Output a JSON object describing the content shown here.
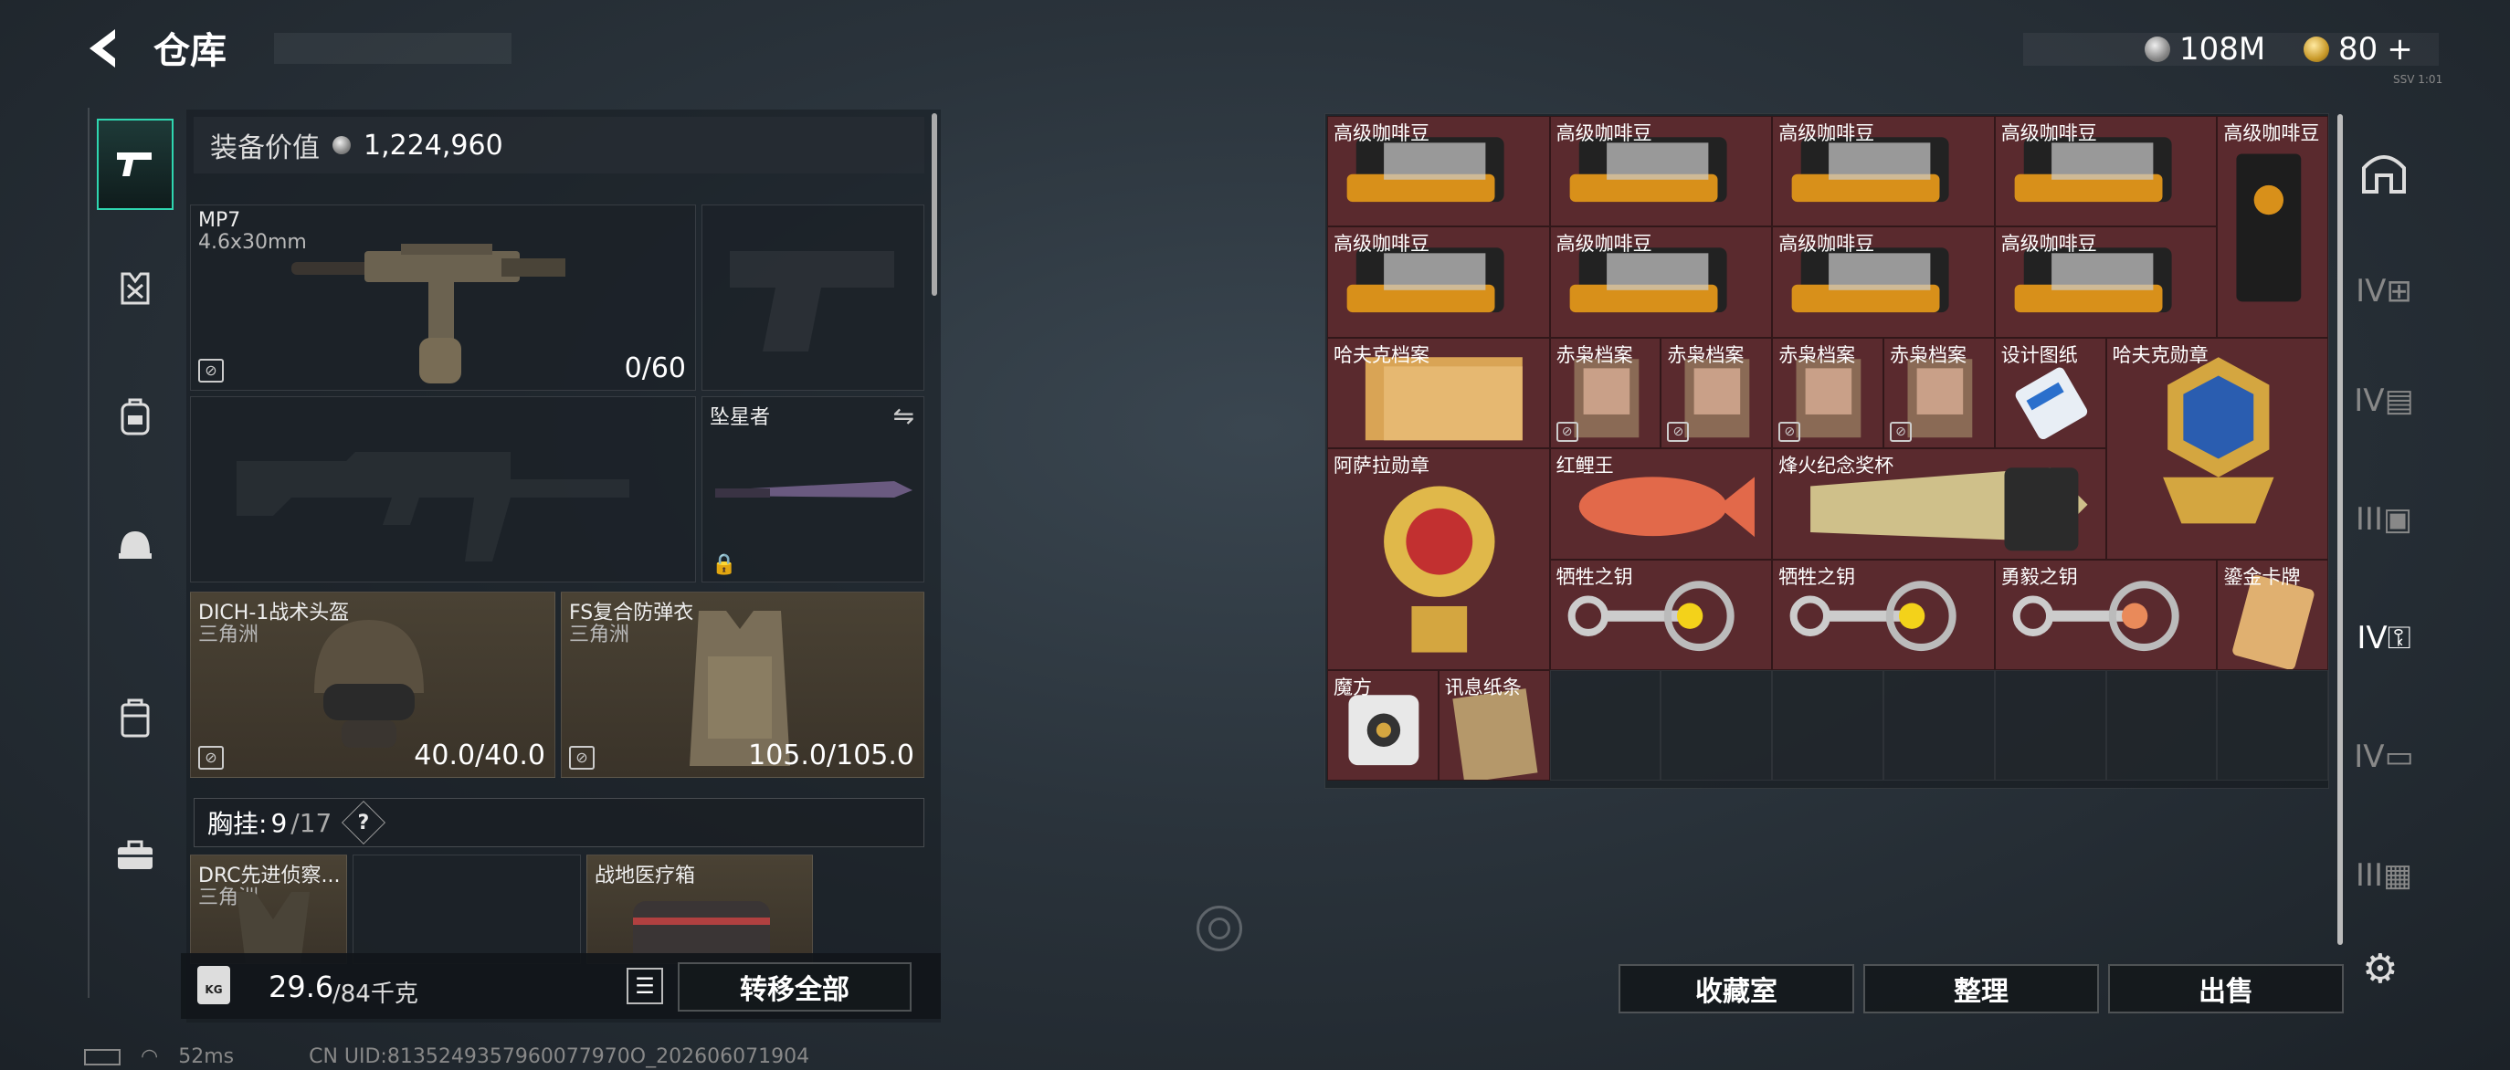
{
  "header": {
    "back_icon": "back-arrow-icon",
    "title": "仓库"
  },
  "currency": {
    "silver": "108M",
    "gold": "80",
    "gold_add": "+",
    "tag": "SSV 1:01"
  },
  "nav": {
    "items": [
      "pistol-icon",
      "vest-icon",
      "backpack-icon",
      "helmet-icon",
      "case-icon",
      "toolbox-icon"
    ],
    "active": 0
  },
  "loadout": {
    "value_label": "装备价值",
    "value": "1,224,960",
    "primary": {
      "name": "MP7",
      "caliber": "4.6x30mm",
      "ammo": "0/60"
    },
    "melee": {
      "name": "坠星者"
    },
    "helmet": {
      "name": "DICH-1战术头盔",
      "faction": "三角洲",
      "durability": "40.0/40.0"
    },
    "armor": {
      "name": "FS复合防弹衣",
      "faction": "三角洲",
      "durability": "105.0/105.0"
    },
    "rig": {
      "label": "胸挂:",
      "count": "9",
      "total": "/17",
      "help": "?"
    },
    "rig_items": [
      {
        "name": "DRC先进侦察...",
        "faction": "三角洲"
      },
      {
        "name": "战地医疗箱"
      }
    ],
    "weight": {
      "current": "29.6",
      "max": "/84千克",
      "badge": "KG"
    },
    "transfer_all": "转移全部"
  },
  "storage": {
    "items": [
      {
        "label": "高级咖啡豆"
      },
      {
        "label": "高级咖啡豆"
      },
      {
        "label": "高级咖啡豆"
      },
      {
        "label": "高级咖啡豆"
      },
      {
        "label": "高级咖啡豆"
      },
      {
        "label": "高级咖啡豆"
      },
      {
        "label": "高级咖啡豆"
      },
      {
        "label": "高级咖啡豆"
      },
      {
        "label": "高级咖啡豆"
      },
      {
        "label": "哈夫克档案"
      },
      {
        "label": "赤枭档案"
      },
      {
        "label": "赤枭档案"
      },
      {
        "label": "赤枭档案"
      },
      {
        "label": "赤枭档案"
      },
      {
        "label": "设计图纸"
      },
      {
        "label": "哈夫克勋章"
      },
      {
        "label": "阿萨拉勋章"
      },
      {
        "label": "红鲤王"
      },
      {
        "label": "烽火纪念奖杯"
      },
      {
        "label": "牺牲之钥"
      },
      {
        "label": "牺牲之钥"
      },
      {
        "label": "勇毅之钥"
      },
      {
        "label": "鎏金卡牌"
      },
      {
        "label": "魔方"
      },
      {
        "label": "讯息纸条"
      }
    ],
    "buttons": {
      "collection": "收藏室",
      "sort": "整理",
      "sell": "出售"
    }
  },
  "right_nav": {
    "items": [
      "safehouse-icon",
      "storage-iv-add-icon",
      "storage-iv-folder-icon",
      "storage-iii-icon",
      "storage-iv-key-icon",
      "storage-iv-card-icon",
      "storage-iii-box-icon"
    ],
    "active": 4
  },
  "status": {
    "ping": "52ms",
    "uid": "CN UID:8135249357960077970O_202606071904"
  }
}
